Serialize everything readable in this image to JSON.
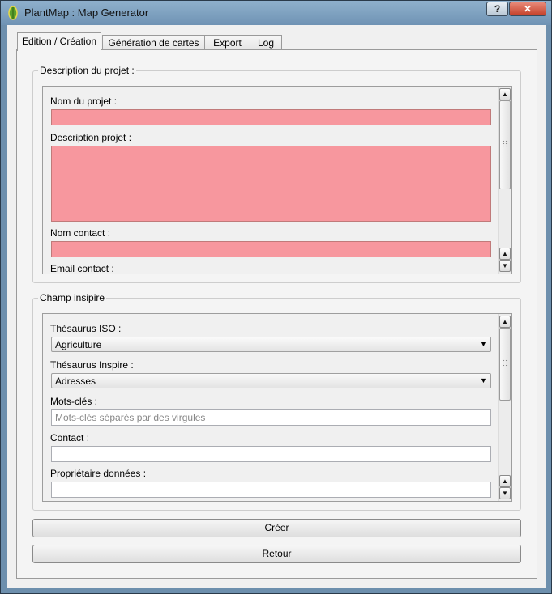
{
  "window": {
    "title": "PlantMap : Map Generator",
    "help_label": "?",
    "close_label": "✕"
  },
  "tabs": [
    "Edition / Création",
    "Génération de cartes",
    "Export",
    "Log"
  ],
  "project_group": {
    "title": "Description du projet :",
    "labels": {
      "name": "Nom du projet :",
      "description": "Description projet :",
      "contact": "Nom contact :",
      "email": "Email contact :"
    },
    "fields": {
      "name": "",
      "description": "",
      "contact": ""
    },
    "invalid_color": "#f7979e"
  },
  "inspire_group": {
    "title": "Champ insipire",
    "labels": {
      "iso": "Thésaurus ISO :",
      "inspire": "Thésaurus Inspire :",
      "keywords": "Mots-clés :",
      "contact": "Contact :",
      "owner": "Propriétaire données :"
    },
    "iso_selected": "Agriculture",
    "inspire_selected": "Adresses",
    "keywords_placeholder": "Mots-clés séparés par des virgules",
    "contact_value": "",
    "owner_value": ""
  },
  "buttons": {
    "create": "Créer",
    "back": "Retour"
  },
  "icons": {
    "up": "▲",
    "down": "▼",
    "dropdown": "▼"
  }
}
